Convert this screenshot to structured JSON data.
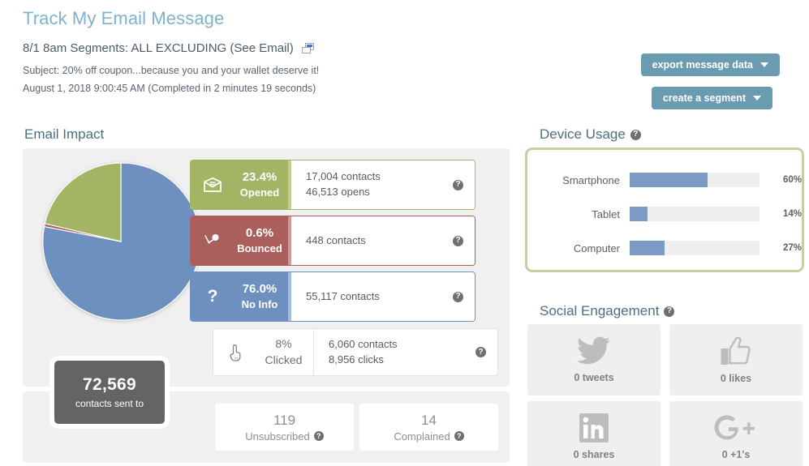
{
  "header": {
    "page_title": "Track My Email Message",
    "message_name": "8/1 8am Segments: ALL EXCLUDING (See Email)",
    "copy_icon": "copy-window-icon",
    "subject": "Subject: 20% off coupon...because you and your wallet deserve it!",
    "date": "August 1, 2018 9:00:45 AM (Completed in 2 minutes 19 seconds)",
    "export_button": "export message data",
    "segment_button": "create a segment",
    "button_color": "#6b9bb0",
    "title_color": "#7fb2cc"
  },
  "email_impact": {
    "heading": "Email Impact",
    "sent": {
      "count": "72,569",
      "label": "contacts sent to"
    },
    "help_icon": "question-mark-icon",
    "chart_data": {
      "type": "pie",
      "title": "Email Impact",
      "categories": [
        "No Info",
        "Opened",
        "Bounced"
      ],
      "values": [
        76.0,
        23.4,
        0.6
      ],
      "colors": [
        "#6d90bf",
        "#a3b465",
        "#ab5f5c"
      ],
      "legend": "right",
      "labels": [
        "76.0% No Info",
        "23.4% Opened",
        "0.6% Bounced"
      ]
    },
    "metrics": [
      {
        "pct": "23.4%",
        "name": "Opened",
        "icon": "open-envelope-icon",
        "detail_1": "17,004 contacts",
        "detail_2": "46,513 opens",
        "color": "#a3b465",
        "accent": "#c2cf94"
      },
      {
        "pct": "0.6%",
        "name": "Bounced",
        "icon": "bounce-arrow-icon",
        "detail_1": "448 contacts",
        "detail_2": "",
        "color": "#ab5f5c",
        "accent": "#cb9b99"
      },
      {
        "pct": "76.0%",
        "name": "No Info",
        "icon": "question-mark-big-icon",
        "detail_1": "55,117 contacts",
        "detail_2": "",
        "color": "#6d90bf",
        "accent": "#a3bcdb"
      }
    ],
    "clicked": {
      "pct": "8%",
      "name": "Clicked",
      "icon": "pointing-hand-icon",
      "detail_1": "6,060 contacts",
      "detail_2": "8,956 clicks"
    },
    "small_tiles": [
      {
        "num": "119",
        "label": "Unsubscribed"
      },
      {
        "num": "14",
        "label": "Complained"
      }
    ]
  },
  "device_usage": {
    "heading": "Device Usage",
    "help_icon": "question-mark-icon",
    "border_color": "#c7cfa2",
    "bar_color": "#7b9bc4",
    "chart_data": {
      "type": "bar",
      "title": "Device Usage",
      "orientation": "horizontal",
      "categories": [
        "Smartphone",
        "Tablet",
        "Computer"
      ],
      "values": [
        60,
        14,
        27
      ],
      "value_labels": [
        "60%",
        "14%",
        "27%"
      ],
      "xlim": [
        0,
        100
      ],
      "ylabel": "",
      "xlabel": "",
      "grid": false
    }
  },
  "social_engagement": {
    "heading": "Social Engagement",
    "help_icon": "question-mark-icon",
    "tiles": [
      {
        "icon": "twitter-bird-icon",
        "label": "0 tweets"
      },
      {
        "icon": "thumbs-up-icon",
        "label": "0 likes"
      },
      {
        "icon": "linkedin-icon",
        "label": "0 shares"
      },
      {
        "icon": "google-plus-icon",
        "label": "0 +1's"
      }
    ]
  }
}
